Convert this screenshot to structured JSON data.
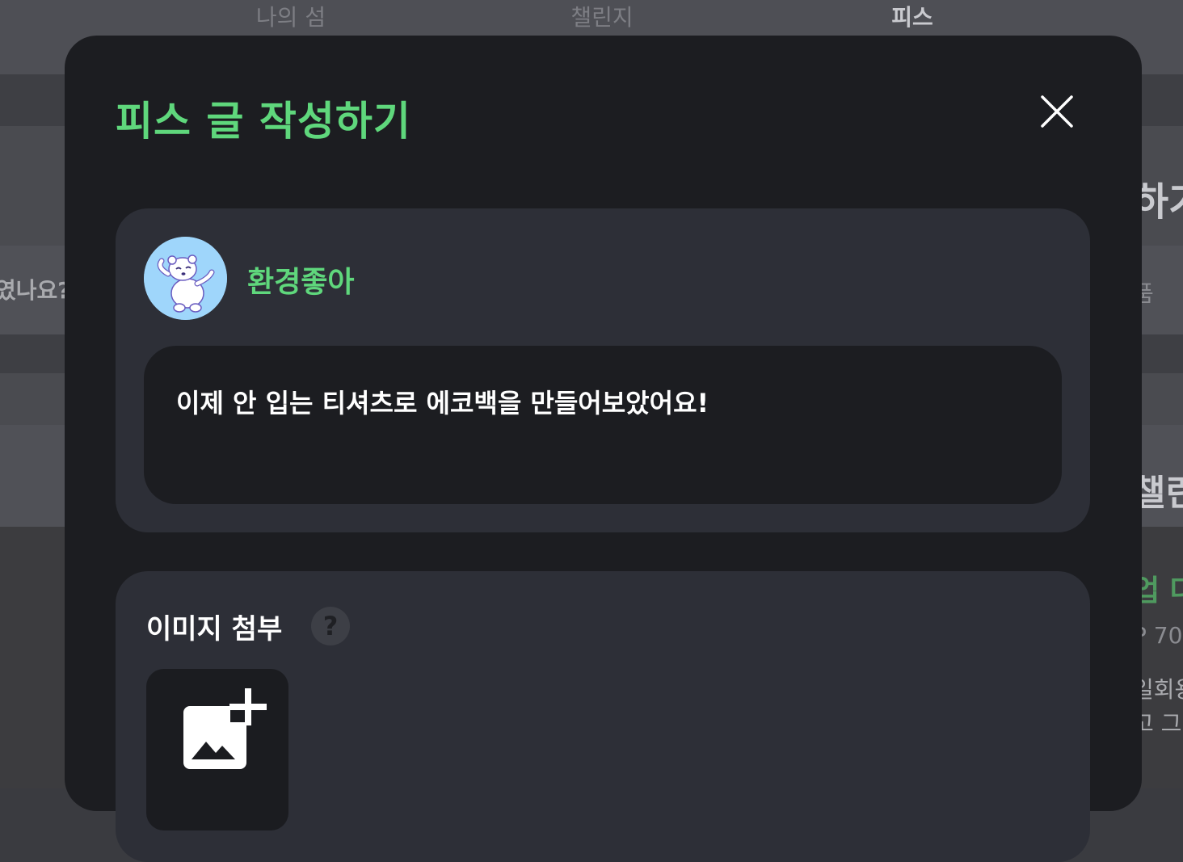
{
  "background": {
    "tabs": [
      {
        "label": "나의 섬"
      },
      {
        "label": "챌린지"
      },
      {
        "label": "피스"
      }
    ],
    "left_text": "였나요?",
    "right_texts": [
      "하기",
      "품",
      "챌린",
      "업 다",
      "P 70",
      "일회용",
      "고 그"
    ]
  },
  "modal": {
    "title": "피스 글 작성하기",
    "close_label": "X",
    "post": {
      "username": "환경좋아",
      "content": "이제 안 입는 티셔츠로 에코백을 만들어보았어요!"
    },
    "attach": {
      "title": "이미지 첨부",
      "help_label": "?"
    }
  },
  "colors": {
    "accent": "#5fd77c",
    "modal_bg": "#1c1d21",
    "card_bg": "#2d2f37"
  }
}
